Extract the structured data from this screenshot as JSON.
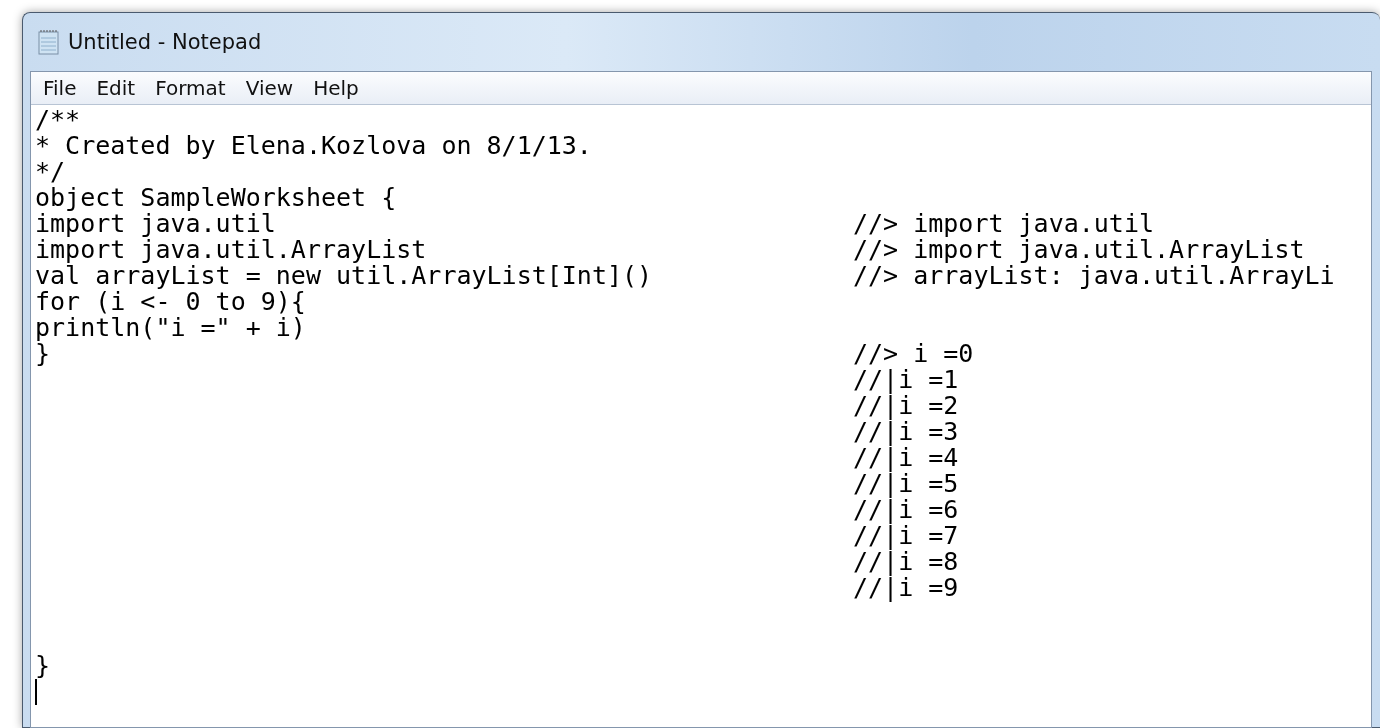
{
  "window": {
    "title": "Untitled - Notepad"
  },
  "menu": [
    "File",
    "Edit",
    "Format",
    "View",
    "Help"
  ],
  "editor": {
    "lines": [
      {
        "code": "/**",
        "cursor": false
      },
      {
        "code": "* Created by Elena.Kozlova on 8/1/13.",
        "cursor": false
      },
      {
        "code": "*/",
        "cursor": false
      },
      {
        "code": "object SampleWorksheet {",
        "cursor": false
      },
      {
        "code": "import java.util",
        "output": "//> import java.util",
        "cursor": false
      },
      {
        "code": "import java.util.ArrayList",
        "output": "//> import java.util.ArrayList",
        "cursor": false
      },
      {
        "code": "val arrayList = new util.ArrayList[Int]()",
        "output": "//> arrayList: java.util.ArrayLi",
        "cursor": false
      },
      {
        "code": "for (i <- 0 to 9){",
        "cursor": false
      },
      {
        "code": "println(\"i =\" + i)",
        "cursor": false
      },
      {
        "code": "}",
        "output": "//> i =0",
        "cursor": false
      },
      {
        "output": "//|i =1",
        "cursor": false
      },
      {
        "output": "//|i =2",
        "cursor": false
      },
      {
        "output": "//|i =3",
        "cursor": false
      },
      {
        "output": "//|i =4",
        "cursor": false
      },
      {
        "output": "//|i =5",
        "cursor": false
      },
      {
        "output": "//|i =6",
        "cursor": false
      },
      {
        "output": "//|i =7",
        "cursor": false
      },
      {
        "output": "//|i =8",
        "cursor": false
      },
      {
        "output": "//|i =9",
        "cursor": false
      },
      {
        "cursor": false
      },
      {
        "cursor": false
      },
      {
        "code": "}",
        "cursor": false
      },
      {
        "cursor": true
      }
    ]
  }
}
